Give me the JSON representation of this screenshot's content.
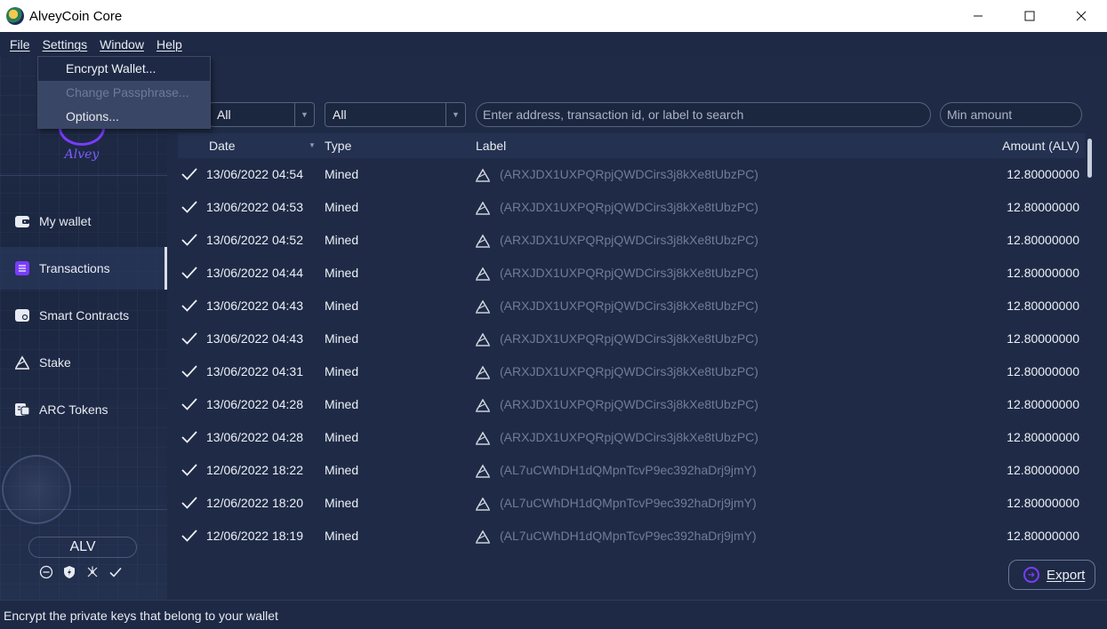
{
  "window": {
    "title": "AlveyCoin Core",
    "minimize": "—",
    "maximize": "☐",
    "close": "✕"
  },
  "menubar": [
    "File",
    "Settings",
    "Window",
    "Help"
  ],
  "settings_menu": {
    "items": [
      {
        "label": "Encrypt Wallet...",
        "state": "highlighted"
      },
      {
        "label": "Change Passphrase...",
        "state": "disabled"
      },
      {
        "label": "Options...",
        "state": "normal"
      }
    ]
  },
  "sidebar": {
    "logo_text": "Alvey",
    "items": [
      {
        "label": "My wallet",
        "icon": "wallet-icon",
        "active": false
      },
      {
        "label": "Transactions",
        "icon": "transactions-icon",
        "active": true
      },
      {
        "label": "Smart Contracts",
        "icon": "smart-contract-icon",
        "active": false
      },
      {
        "label": "Stake",
        "icon": "stake-icon",
        "active": false
      },
      {
        "label": "ARC Tokens",
        "icon": "tokens-icon",
        "active": false
      }
    ],
    "unit": "ALV",
    "status_icons": [
      "hd-wallet-icon",
      "staking-icon",
      "network-icon",
      "synced-check-icon"
    ]
  },
  "filters": {
    "date_filter": "All",
    "type_filter": "All",
    "search_placeholder": "Enter address, transaction id, or label to search",
    "min_amount_placeholder": "Min amount"
  },
  "table": {
    "columns": {
      "date": "Date",
      "type": "Type",
      "label": "Label",
      "amount": "Amount (ALV)"
    },
    "rows": [
      {
        "date": "13/06/2022 04:54",
        "type": "Mined",
        "label": "(ARXJDX1UXPQRpjQWDCirs3j8kXe8tUbzPC)",
        "amount": "12.80000000"
      },
      {
        "date": "13/06/2022 04:53",
        "type": "Mined",
        "label": "(ARXJDX1UXPQRpjQWDCirs3j8kXe8tUbzPC)",
        "amount": "12.80000000"
      },
      {
        "date": "13/06/2022 04:52",
        "type": "Mined",
        "label": "(ARXJDX1UXPQRpjQWDCirs3j8kXe8tUbzPC)",
        "amount": "12.80000000"
      },
      {
        "date": "13/06/2022 04:44",
        "type": "Mined",
        "label": "(ARXJDX1UXPQRpjQWDCirs3j8kXe8tUbzPC)",
        "amount": "12.80000000"
      },
      {
        "date": "13/06/2022 04:43",
        "type": "Mined",
        "label": "(ARXJDX1UXPQRpjQWDCirs3j8kXe8tUbzPC)",
        "amount": "12.80000000"
      },
      {
        "date": "13/06/2022 04:43",
        "type": "Mined",
        "label": "(ARXJDX1UXPQRpjQWDCirs3j8kXe8tUbzPC)",
        "amount": "12.80000000"
      },
      {
        "date": "13/06/2022 04:31",
        "type": "Mined",
        "label": "(ARXJDX1UXPQRpjQWDCirs3j8kXe8tUbzPC)",
        "amount": "12.80000000"
      },
      {
        "date": "13/06/2022 04:28",
        "type": "Mined",
        "label": "(ARXJDX1UXPQRpjQWDCirs3j8kXe8tUbzPC)",
        "amount": "12.80000000"
      },
      {
        "date": "13/06/2022 04:28",
        "type": "Mined",
        "label": "(ARXJDX1UXPQRpjQWDCirs3j8kXe8tUbzPC)",
        "amount": "12.80000000"
      },
      {
        "date": "12/06/2022 18:22",
        "type": "Mined",
        "label": "(AL7uCWhDH1dQMpnTcvP9ec392haDrj9jmY)",
        "amount": "12.80000000"
      },
      {
        "date": "12/06/2022 18:20",
        "type": "Mined",
        "label": "(AL7uCWhDH1dQMpnTcvP9ec392haDrj9jmY)",
        "amount": "12.80000000"
      },
      {
        "date": "12/06/2022 18:19",
        "type": "Mined",
        "label": "(AL7uCWhDH1dQMpnTcvP9ec392haDrj9jmY)",
        "amount": "12.80000000"
      }
    ]
  },
  "export_button": "Export",
  "statusbar": "Encrypt the private keys that belong to your wallet",
  "colors": {
    "accent": "#7a3cff",
    "background": "#1f2b46",
    "label_muted": "#6f7c9a"
  }
}
